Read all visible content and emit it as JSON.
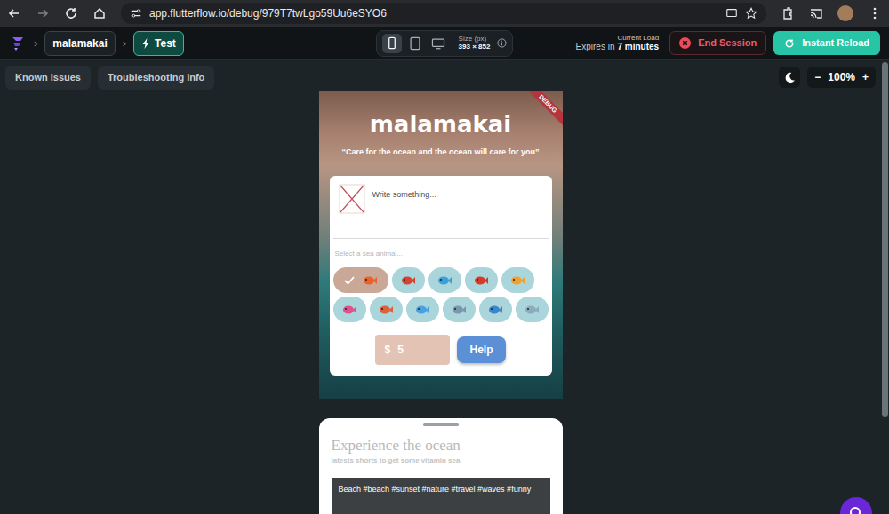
{
  "browser": {
    "url": "app.flutterflow.io/debug/979T7twLgo59Uu6eSYO6"
  },
  "toolbar": {
    "project": "malamakai",
    "mode": "Test",
    "devices": [
      {
        "selected": true
      },
      {
        "selected": false
      },
      {
        "selected": false
      }
    ],
    "size_label": "Size (px)",
    "size": "393 × 852",
    "load_label": "Current Load",
    "expires_prefix": "Expires in",
    "expires": "7 minutes",
    "end_session": "End Session",
    "instant_reload": "Instant Reload"
  },
  "canvas": {
    "links": [
      "Known Issues",
      "Troubleshooting Info"
    ],
    "zoom_out": "−",
    "zoom": "100%",
    "zoom_in": "+"
  },
  "app": {
    "banner": "DEBUG",
    "title": "malamakai",
    "quote": "“Care for the ocean and the ocean will care for you”",
    "post_placeholder": "Write something...",
    "animal_prompt": "Select a sea animal...",
    "animals": [
      {
        "selected": true,
        "color": "#e8622c"
      },
      {
        "selected": false,
        "color": "#d8402f"
      },
      {
        "selected": false,
        "color": "#3aa0d8"
      },
      {
        "selected": false,
        "color": "#d23a2a"
      },
      {
        "selected": false,
        "color": "#f0a030"
      },
      {
        "selected": false,
        "color": "#e0508a"
      },
      {
        "selected": false,
        "color": "#e0603c"
      },
      {
        "selected": false,
        "color": "#4aa0e0"
      },
      {
        "selected": false,
        "color": "#7a98ac"
      },
      {
        "selected": false,
        "color": "#3a86cc"
      },
      {
        "selected": false,
        "color": "#8aacbc"
      }
    ],
    "currency": "$",
    "amount": "5",
    "help": "Help"
  },
  "feed": {
    "title": "Experience the ocean",
    "subtitle": "latests shorts to get some vitamin sea",
    "video_caption": "Beach #beach #sunset #nature #travel #waves #funny"
  }
}
